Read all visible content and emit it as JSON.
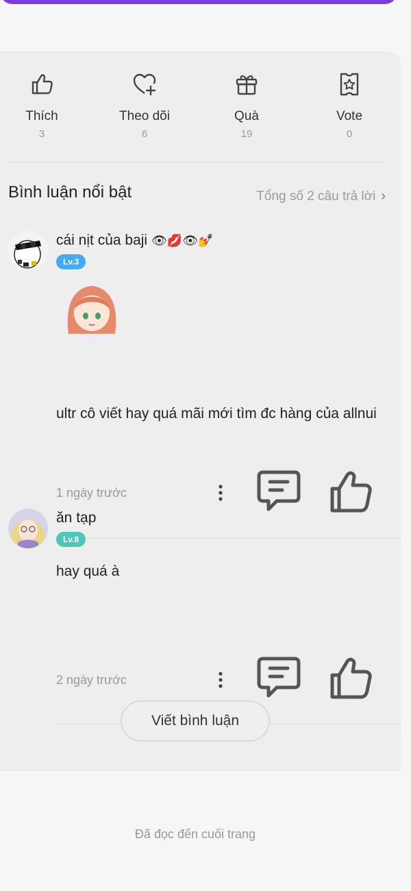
{
  "stats": [
    {
      "label": "Thích",
      "count": "3",
      "icon": "thumbs-up-icon"
    },
    {
      "label": "Theo dõi",
      "count": "6",
      "icon": "heart-plus-icon"
    },
    {
      "label": "Quà",
      "count": "19",
      "icon": "gift-icon"
    },
    {
      "label": "Vote",
      "count": "0",
      "icon": "vote-ticket-icon"
    }
  ],
  "comments_section": {
    "title": "Bình luận nổi bật",
    "total_link": "Tổng số 2 câu trả lời"
  },
  "comments": [
    {
      "name": "cái nịt của baji",
      "emojis": "👁💋👁💅",
      "level": "Lv.3",
      "level_color": "#49a9ee",
      "text": "ultr cô viết hay quá mãi mới tìm đc hàng của allnui",
      "time": "1 ngày trước",
      "has_sticker": true
    },
    {
      "name": "ăn tạp",
      "emojis": "",
      "level": "Lv.8",
      "level_color": "#4fc6b8",
      "text": "hay quá à",
      "time": "2 ngày trước",
      "has_sticker": false
    }
  ],
  "write_comment_label": "Viết bình luận",
  "end_of_page": "Đã đọc đến cuối trang",
  "colors": {
    "accent": "#7a3ee0",
    "card_bg": "#eeeeee",
    "page_bg": "#f6f6f7",
    "icon_stroke": "#555555"
  }
}
